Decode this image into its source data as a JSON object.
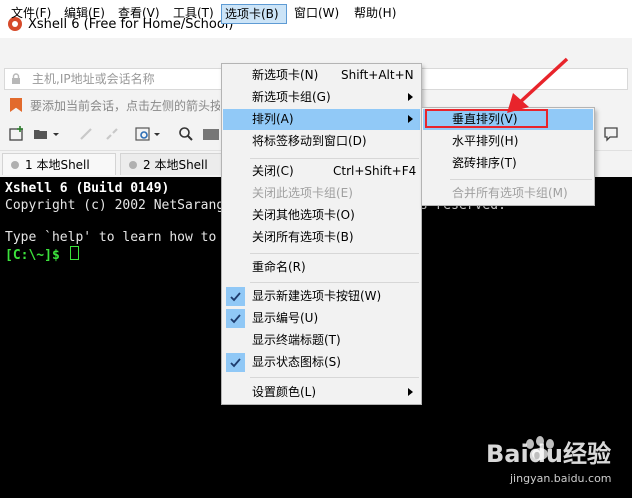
{
  "window": {
    "title": "Xshell 6 (Free for Home/School)"
  },
  "menubar": {
    "items": [
      "文件(F)",
      "编辑(E)",
      "查看(V)",
      "工具(T)",
      "选项卡(B)",
      "窗口(W)",
      "帮助(H)"
    ]
  },
  "address": {
    "placeholder": "主机,IP地址或会话名称"
  },
  "hint": {
    "text": "要添加当前会话，点击左侧的箭头按钮"
  },
  "tabs": [
    {
      "label": "1 本地Shell"
    },
    {
      "label": "2 本地Shell"
    }
  ],
  "terminal": {
    "lines": [
      "Xshell 6 (Build 0149)",
      "Copyright (c) 2002 NetSarang Computer, Inc. All rights reserved.",
      "Type `help' to learn how to use Xshell prompt."
    ],
    "prompt": "[C:\\~]$ "
  },
  "tab_menu": {
    "items": [
      {
        "label": "新选项卡(N)",
        "shortcut": "Shift+Alt+N"
      },
      {
        "label": "新选项卡组(G)"
      },
      {
        "label": "排列(A)"
      },
      {
        "label": "将标签移动到窗口(D)"
      },
      {
        "label": "关闭(C)",
        "shortcut": "Ctrl+Shift+F4"
      },
      {
        "label": "关闭此选项卡组(E)"
      },
      {
        "label": "关闭其他选项卡(O)"
      },
      {
        "label": "关闭所有选项卡(B)"
      },
      {
        "label": "重命名(R)"
      },
      {
        "label": "显示新建选项卡按钮(W)"
      },
      {
        "label": "显示编号(U)"
      },
      {
        "label": "显示终端标题(T)"
      },
      {
        "label": "显示状态图标(S)"
      },
      {
        "label": "设置颜色(L)"
      }
    ]
  },
  "arrange_menu": {
    "items": [
      {
        "label": "垂直排列(V)"
      },
      {
        "label": "水平排列(H)"
      },
      {
        "label": "瓷砖排序(T)"
      },
      {
        "label": "合并所有选项卡组(M)"
      }
    ]
  },
  "watermark": {
    "brand": "Baidu经验",
    "url": "jingyan.baidu.com"
  },
  "colors": {
    "highlight": "#91c9f7",
    "annotation": "#e8242b",
    "prompt": "#3ce23c"
  }
}
